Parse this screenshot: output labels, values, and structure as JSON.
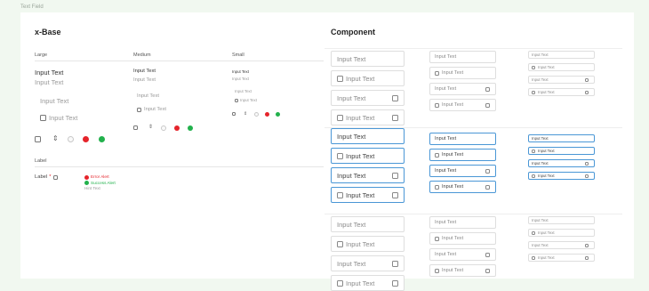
{
  "frame_label": "Text Field",
  "base": {
    "title": "x-Base",
    "sizes": {
      "large": "Large",
      "medium": "Medium",
      "small": "Small"
    },
    "input_text": "Input Text",
    "label_section": "Label",
    "label_text": "Label",
    "required_mark": "*",
    "error_alert": "Error Alert",
    "success_alert": "Success Alert",
    "hint_text": "Hint Text",
    "stepper_glyph": "⇕"
  },
  "component": {
    "title": "Component",
    "input_text": "Input Text",
    "focus_color": "#4a97d6"
  },
  "colors": {
    "error": "#e5242b",
    "success": "#22b14c",
    "background": "#f1f8f0"
  }
}
